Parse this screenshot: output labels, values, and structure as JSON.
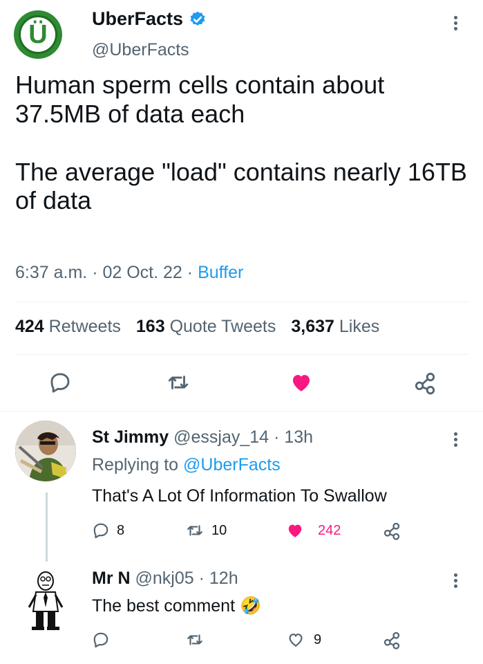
{
  "tweet": {
    "avatar_letter": "Ü",
    "display_name": "UberFacts",
    "handle": "@UberFacts",
    "paragraph1": "Human sperm cells contain about 37.5MB of data each",
    "paragraph2": "The average \"load\" contains nearly 16TB of data",
    "time": "6:37 a.m.",
    "dot": "·",
    "date": "02 Oct. 22",
    "source": "Buffer",
    "retweets_count": "424",
    "retweets_label": "Retweets",
    "quotes_count": "163",
    "quotes_label": "Quote Tweets",
    "likes_count": "3,637",
    "likes_label": "Likes"
  },
  "replies": [
    {
      "name": "St Jimmy",
      "handle": "@essjay_14",
      "age": "13h",
      "replying_prefix": "Replying to",
      "replying_to": "@UberFacts",
      "text": "That's A Lot Of Information To Swallow",
      "replies": "8",
      "retweets": "10",
      "likes": "242"
    },
    {
      "name": "Mr N",
      "handle": "@nkj05",
      "age": "12h",
      "text": "The best comment",
      "emoji": "🤣",
      "likes": "9"
    }
  ],
  "colors": {
    "accent": "#1d9bf0",
    "like": "#f91880",
    "muted": "#536471"
  }
}
